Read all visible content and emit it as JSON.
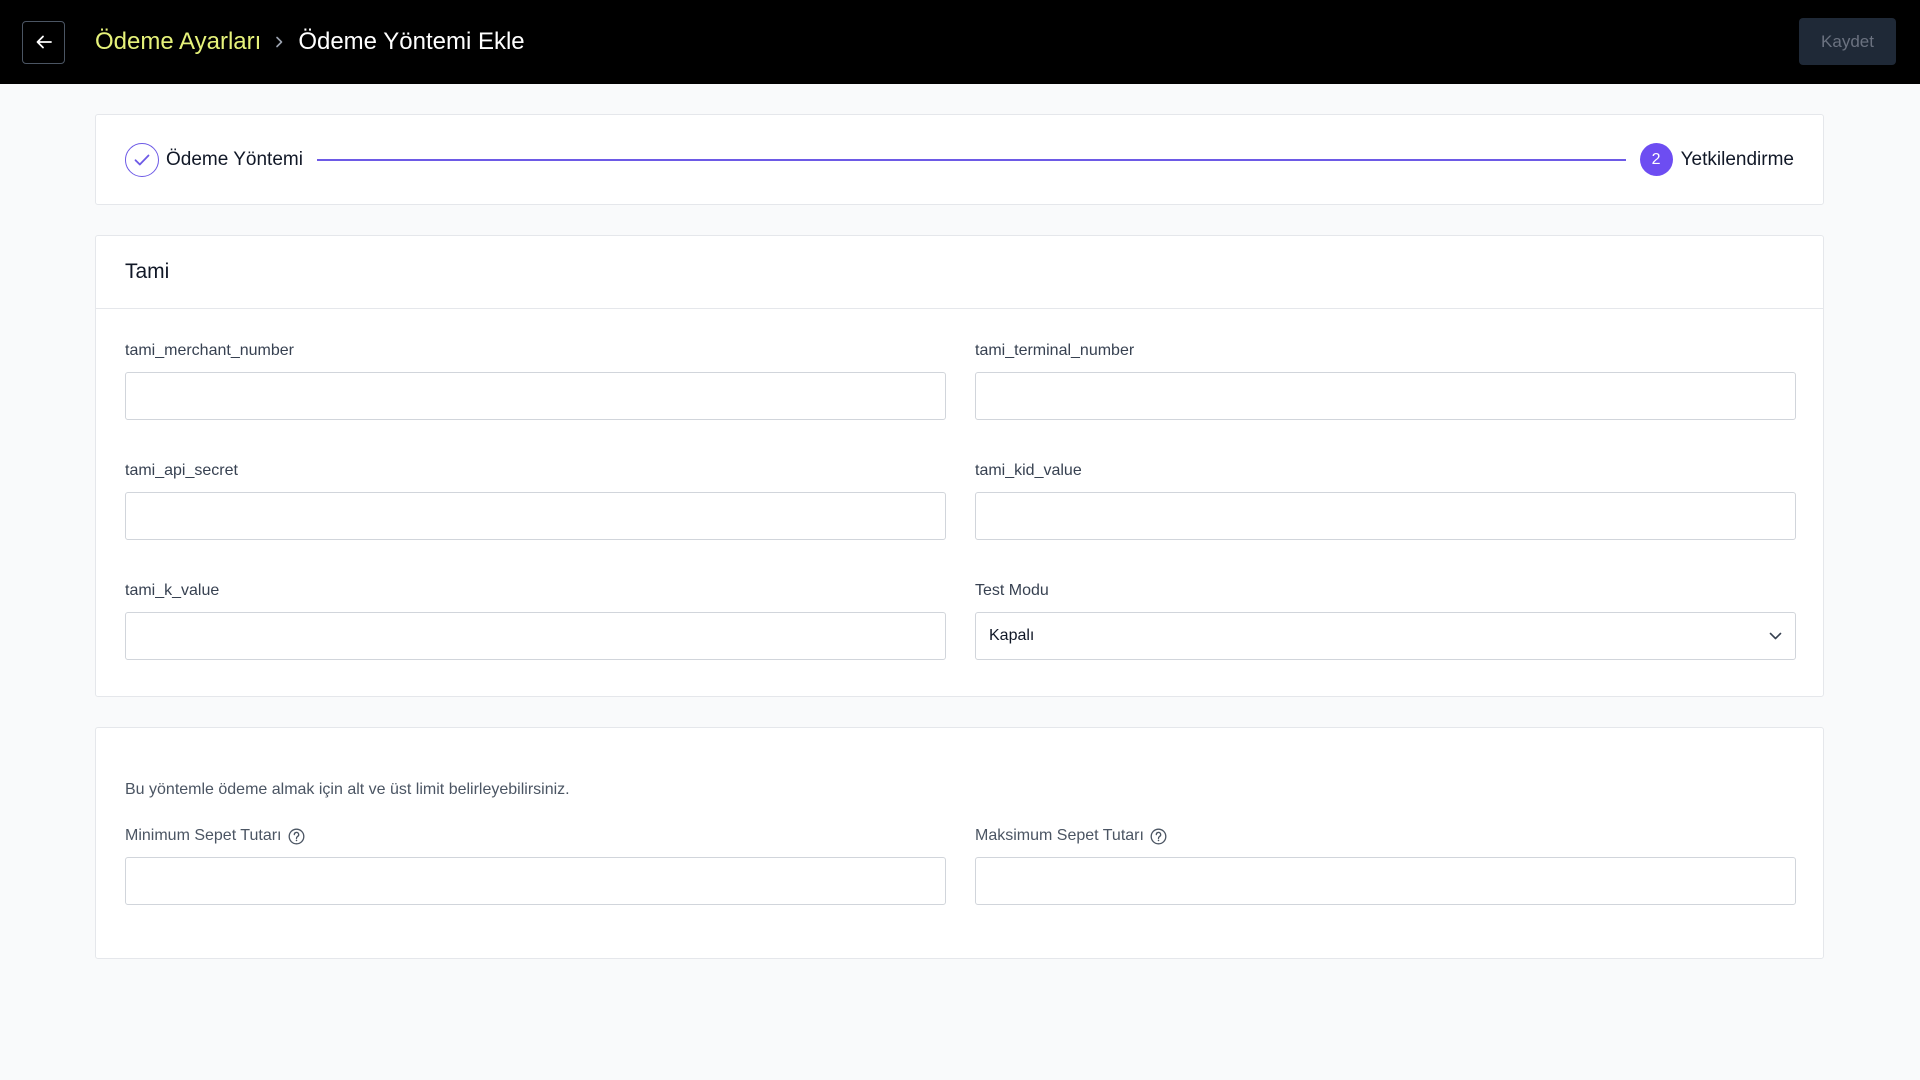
{
  "header": {
    "breadcrumb_parent": "Ödeme Ayarları",
    "breadcrumb_current": "Ödeme Yöntemi Ekle",
    "save_label": "Kaydet"
  },
  "stepper": {
    "step1_label": "Ödeme Yöntemi",
    "step2_number": "2",
    "step2_label": "Yetkilendirme"
  },
  "form": {
    "title": "Tami",
    "fields": {
      "merchant_number": {
        "label": "tami_merchant_number",
        "value": ""
      },
      "terminal_number": {
        "label": "tami_terminal_number",
        "value": ""
      },
      "api_secret": {
        "label": "tami_api_secret",
        "value": ""
      },
      "kid_value": {
        "label": "tami_kid_value",
        "value": ""
      },
      "k_value": {
        "label": "tami_k_value",
        "value": ""
      },
      "test_mode": {
        "label": "Test Modu",
        "selected": "Kapalı"
      }
    }
  },
  "limits": {
    "description": "Bu yöntemle ödeme almak için alt ve üst limit belirleyebilirsiniz.",
    "min_label": "Minimum Sepet Tutarı",
    "max_label": "Maksimum Sepet Tutarı",
    "min_value": "",
    "max_value": ""
  },
  "colors": {
    "accent": "#6d4df2",
    "breadcrumb_link": "#e6f27a",
    "topbar": "#000000"
  }
}
